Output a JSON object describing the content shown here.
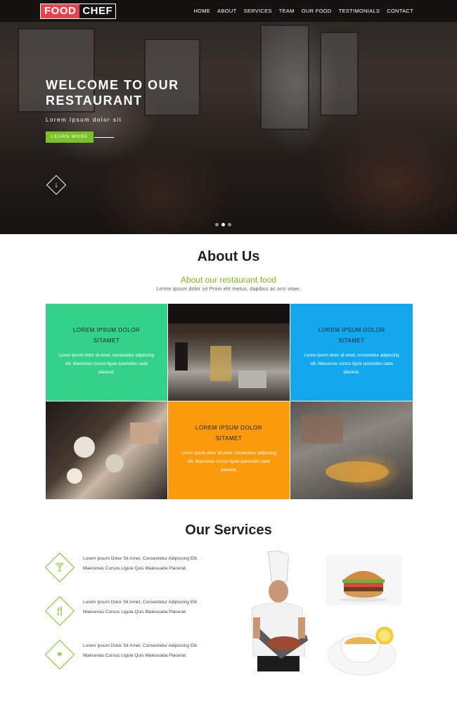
{
  "brand": {
    "part1": "FOOD",
    "part2": "CHEF"
  },
  "nav": [
    "HOME",
    "ABOUT",
    "SERVICES",
    "TEAM",
    "OUR FOOD",
    "TESTIMONIALS",
    "CONTACT"
  ],
  "hero": {
    "title": "WELCOME TO OUR RESTAURANT",
    "subtitle": "Lorem Ipsum dolor sit",
    "button": "LEARN MORE",
    "slides": 3,
    "active_slide": 1
  },
  "about": {
    "title": "About Us",
    "subtitle": "About our restaurant food",
    "description": "Lorem ipsum dolor sit Proin elit metus, dapibus ac orci vitae.",
    "cards": [
      {
        "heading": "LOREM IPSUM DOLOR SITAMET",
        "text": "Lorem ipsum dolor sit amet, consectetur adipiscing elit. Maecenas cursus ligula quismales uada placerat.",
        "color": "#34d18b"
      },
      {
        "heading": "LOREM IPSUM DOLOR SITAMET",
        "text": "Lorem ipsum dolor sit amet, consectetur adipiscing elit. Maecenas cursus ligula quismales uada placerat.",
        "color": "#13a8ee"
      },
      {
        "heading": "LOREM IPSUM DOLOR SITAMET",
        "text": "Lorem ipsum dolor sit amet, consectetur adipiscing elit. Maecenas cursus ligula quismales uada placerat.",
        "color": "#fb9a0a"
      }
    ]
  },
  "services": {
    "title": "Our Services",
    "items": [
      {
        "icon": "cocktail-icon",
        "text": "Lorem Ipsum Dolor Sit Amet, Consectetur Adipiscing Elit. Maecenas Cursus Ligula Quis Malesuada Placerat."
      },
      {
        "icon": "cutlery-icon",
        "text": "Lorem Ipsum Dolor Sit Amet, Consectetur Adipiscing Elit. Maecenas Cursus Ligula Quis Malesuada Placerat."
      },
      {
        "icon": "spoon-icon",
        "text": "Lorem Ipsum Dolor Sit Amet, Consectetur Adipiscing Elit. Maecenas Cursus Ligula Quis Malesuada Placerat."
      }
    ]
  },
  "colors": {
    "accent_green": "#7cc12a",
    "brand_red": "#e8434f"
  }
}
